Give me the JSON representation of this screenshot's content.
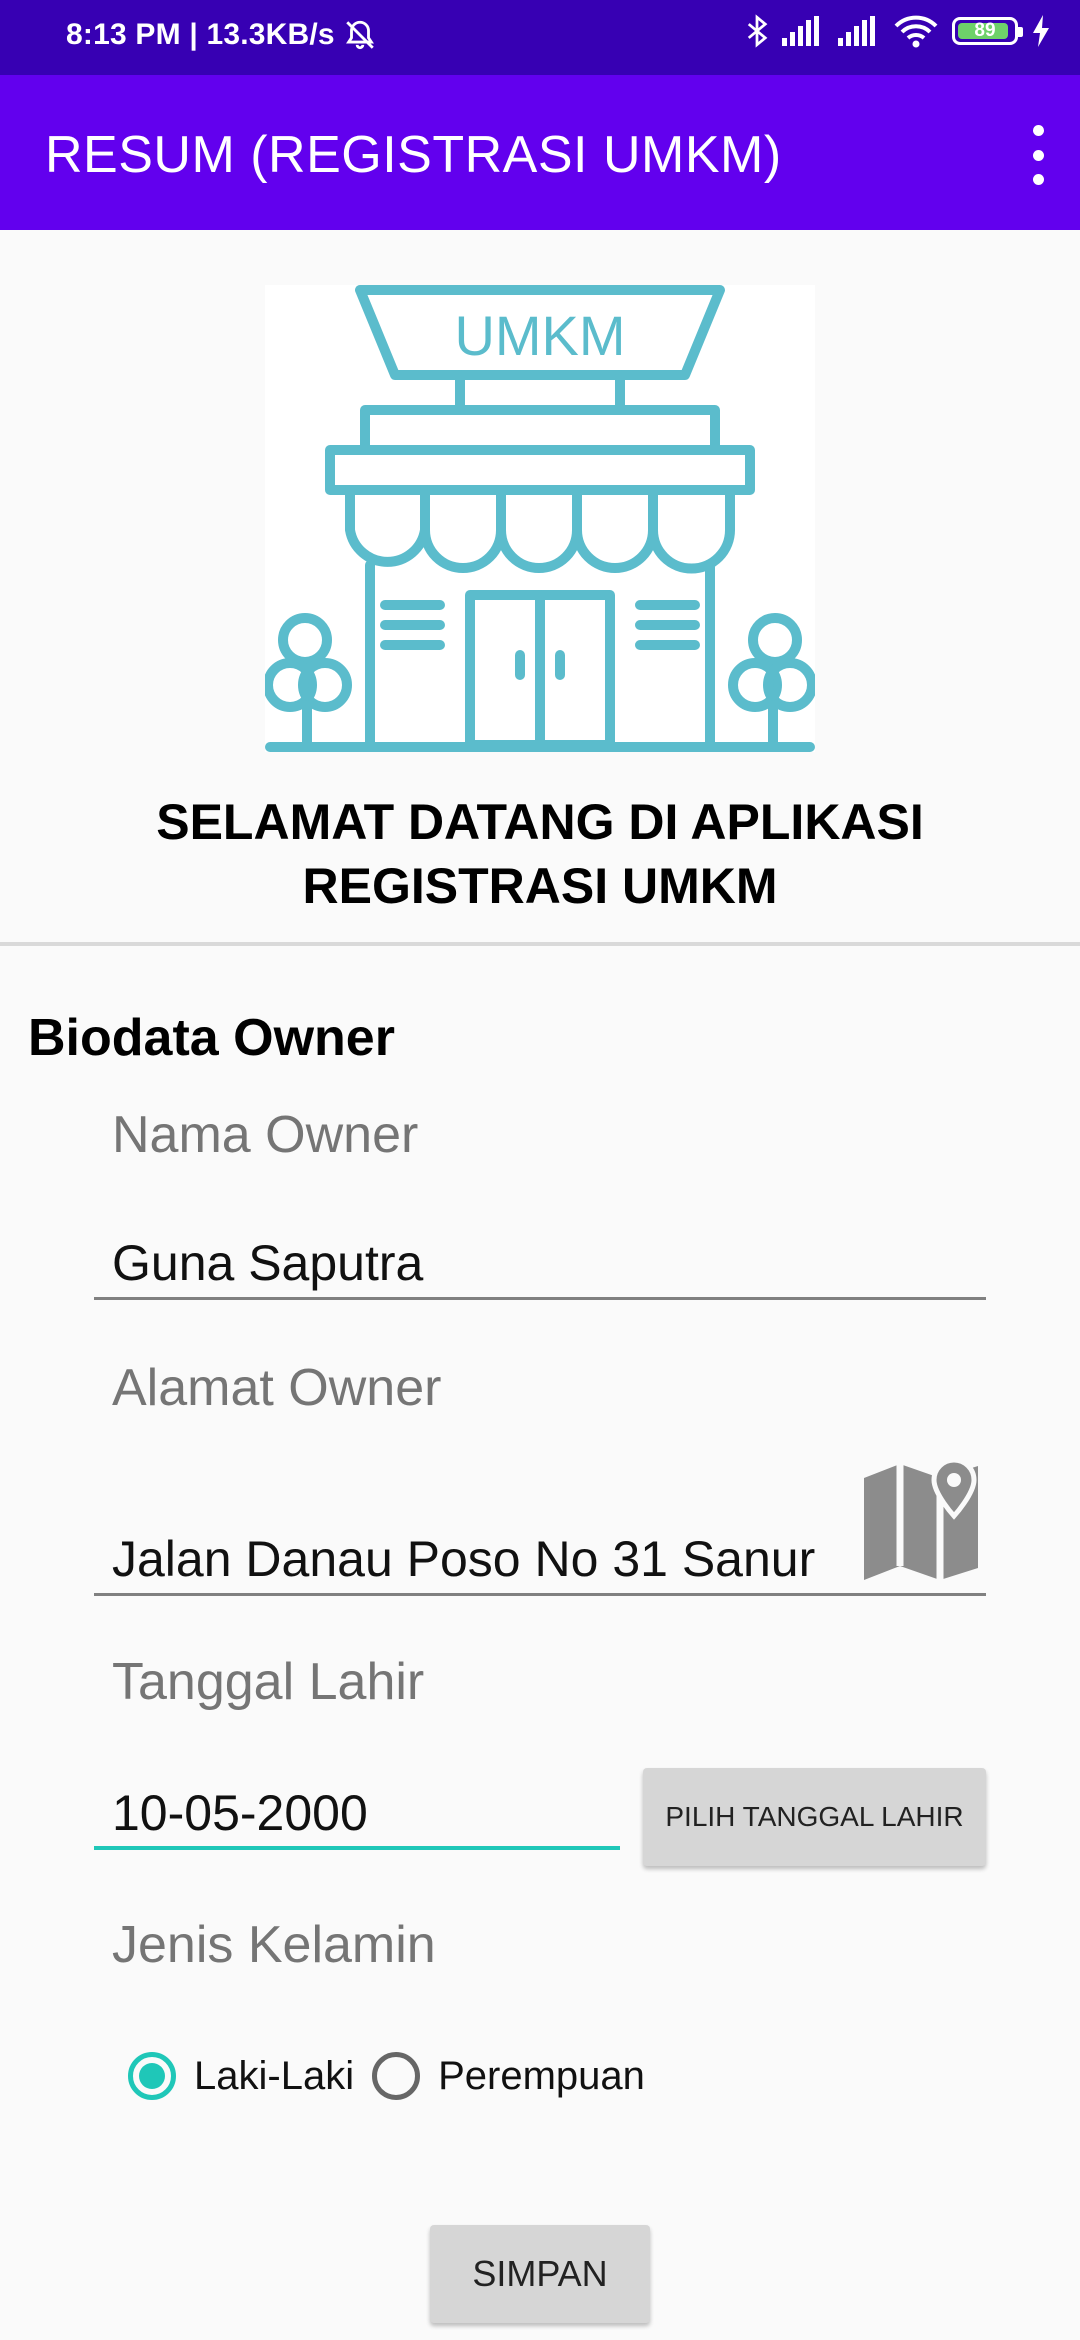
{
  "status_bar": {
    "time_speed": "8:13 PM | 13.3KB/s",
    "battery": "89",
    "icons": [
      "mute-icon",
      "bluetooth-icon",
      "signal-icon",
      "signal-icon",
      "wifi-icon",
      "battery-icon",
      "charging-icon"
    ]
  },
  "app_bar": {
    "title": "RESUM (REGISTRASI UMKM)",
    "menu_icon": "more-vert-icon"
  },
  "logo": {
    "sign_text": "UMKM",
    "color": "#5bbccc"
  },
  "welcome": {
    "line1": "SELAMAT DATANG DI APLIKASI",
    "line2": "REGISTRASI UMKM"
  },
  "form": {
    "section_title": "Biodata Owner",
    "nama_label": "Nama Owner",
    "nama_value": "Guna Saputra",
    "alamat_label": "Alamat Owner",
    "alamat_value": "Jalan Danau Poso No 31 Sanur",
    "map_icon": "map-icon",
    "tanggal_label": "Tanggal Lahir",
    "tanggal_value": "10-05-2000",
    "pilih_button": "PILIH TANGGAL LAHIR",
    "jenis_label": "Jenis Kelamin",
    "radio_options": [
      "Laki-Laki",
      "Perempuan"
    ],
    "radio_selected": "Laki-Laki",
    "save_button": "SIMPAN"
  },
  "colors": {
    "status_bar": "#3700b3",
    "app_bar": "#6200ee",
    "accent": "#1fc7b8"
  }
}
